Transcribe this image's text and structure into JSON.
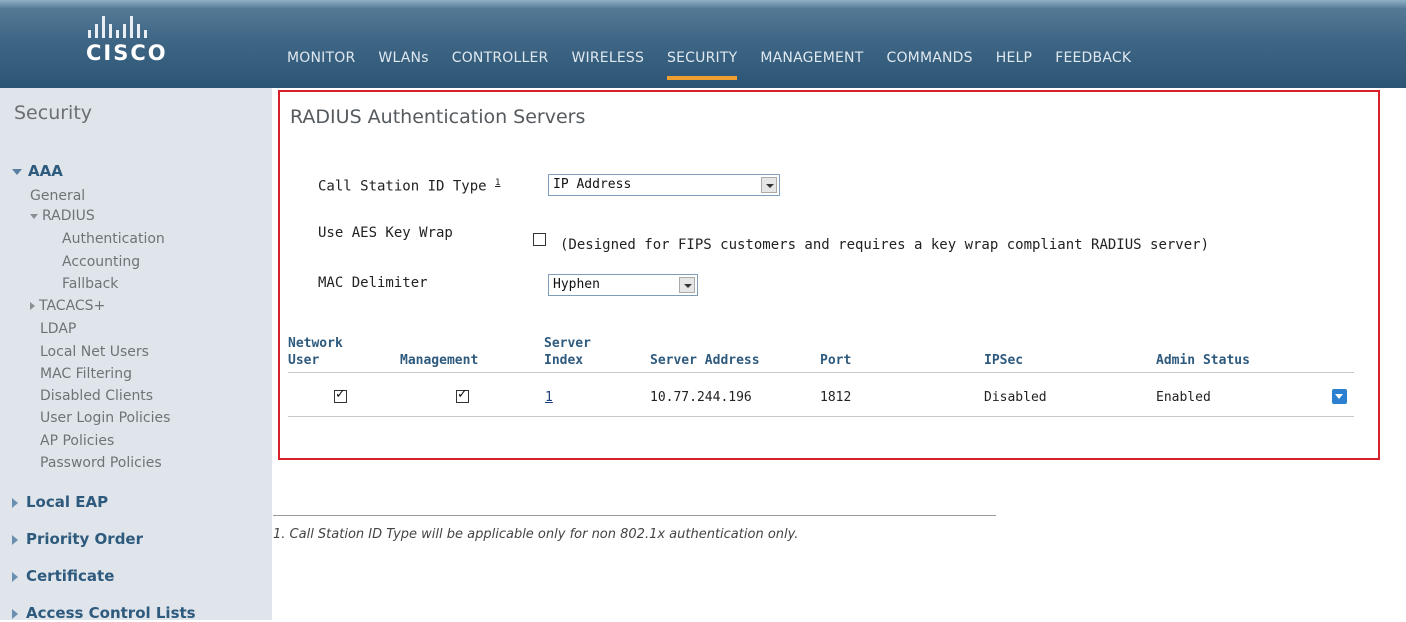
{
  "brand": {
    "name": "CISCO"
  },
  "nav": [
    {
      "label": "MONITOR"
    },
    {
      "label": "WLANs"
    },
    {
      "label": "CONTROLLER"
    },
    {
      "label": "WIRELESS"
    },
    {
      "label": "SECURITY",
      "active": true
    },
    {
      "label": "MANAGEMENT"
    },
    {
      "label": "COMMANDS"
    },
    {
      "label": "HELP"
    },
    {
      "label": "FEEDBACK"
    }
  ],
  "sidebar": {
    "title": "Security",
    "aaa": "AAA",
    "general": "General",
    "radius": "RADIUS",
    "authentication": "Authentication",
    "accounting": "Accounting",
    "fallback": "Fallback",
    "tacacs": "TACACS+",
    "ldap": "LDAP",
    "local_net_users": "Local Net Users",
    "mac_filtering": "MAC Filtering",
    "disabled_clients": "Disabled Clients",
    "user_login_policies": "User Login Policies",
    "ap_policies": "AP Policies",
    "password_policies": "Password Policies",
    "local_eap": "Local EAP",
    "priority_order": "Priority Order",
    "certificate": "Certificate",
    "acl": "Access Control Lists"
  },
  "main": {
    "title": "RADIUS Authentication Servers",
    "call_station_label": "Call Station ID Type",
    "call_station_footnote_mark": "1",
    "call_station_value": "IP Address",
    "aes_label": "Use AES Key Wrap",
    "aes_checked": false,
    "aes_note": "(Designed for FIPS customers and requires a key wrap compliant RADIUS server)",
    "mac_delim_label": "MAC Delimiter",
    "mac_delim_value": "Hyphen",
    "table": {
      "headers": {
        "network_user_1": "Network",
        "network_user_2": "User",
        "management": "Management",
        "server_index_1": "Server",
        "server_index_2": "Index",
        "server_address": "Server Address",
        "port": "Port",
        "ipsec": "IPSec",
        "admin_status": "Admin Status"
      },
      "rows": [
        {
          "network_user": true,
          "management": true,
          "server_index": "1",
          "server_address": "10.77.244.196",
          "port": "1812",
          "ipsec": "Disabled",
          "admin_status": "Enabled"
        }
      ]
    }
  },
  "footnote": "1. Call Station ID Type will be applicable only for non 802.1x authentication only."
}
